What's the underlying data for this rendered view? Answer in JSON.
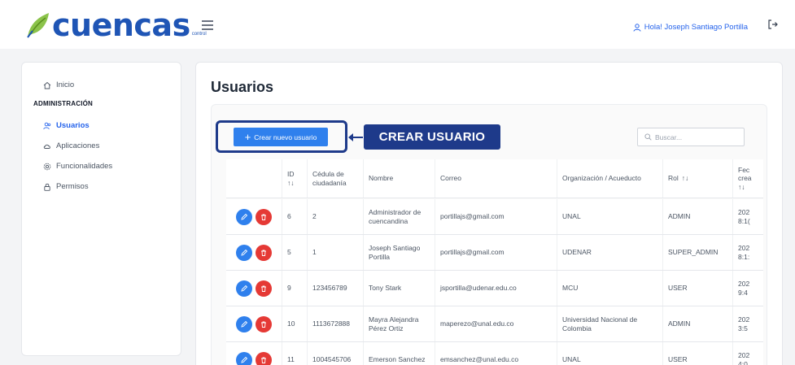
{
  "header": {
    "logo_text": "cuencas",
    "logo_sub": "control",
    "greeting": "Hola! Joseph Santiago Portilla"
  },
  "sidebar": {
    "home": "Inicio",
    "section": "ADMINISTRACIÓN",
    "items": [
      {
        "label": "Usuarios",
        "icon": "users-icon",
        "active": true
      },
      {
        "label": "Aplicaciones",
        "icon": "cloud-icon",
        "active": false
      },
      {
        "label": "Funcionalidades",
        "icon": "gear-icon",
        "active": false
      },
      {
        "label": "Permisos",
        "icon": "lock-icon",
        "active": false
      }
    ]
  },
  "main": {
    "title": "Usuarios",
    "create_button": "Crear nuevo usuario",
    "annotation": "CREAR USUARIO",
    "search_placeholder": "Buscar..."
  },
  "table": {
    "headers": {
      "id": "ID",
      "cedula": "Cédula de ciudadanía",
      "nombre": "Nombre",
      "correo": "Correo",
      "org": "Organización / Acueducto",
      "rol": "Rol",
      "fecha": "Fec crea"
    },
    "rows": [
      {
        "id": "6",
        "cedula": "2",
        "nombre": "Administrador de cuencandina",
        "correo": "portillajs@gmail.com",
        "org": "UNAL",
        "rol": "ADMIN",
        "fecha": "202 8:1("
      },
      {
        "id": "5",
        "cedula": "1",
        "nombre": "Joseph Santiago Portilla",
        "correo": "portillajs@gmail.com",
        "org": "UDENAR",
        "rol": "SUPER_ADMIN",
        "fecha": "202 8:1:"
      },
      {
        "id": "9",
        "cedula": "123456789",
        "nombre": "Tony Stark",
        "correo": "jsportilla@udenar.edu.co",
        "org": "MCU",
        "rol": "USER",
        "fecha": "202 9:4"
      },
      {
        "id": "10",
        "cedula": "1113672888",
        "nombre": "Mayra Alejandra Pérez Ortiz",
        "correo": "maperezo@unal.edu.co",
        "org": "Universidad Nacional de Colombia",
        "rol": "ADMIN",
        "fecha": "202 3:5"
      },
      {
        "id": "11",
        "cedula": "1004545706",
        "nombre": "Emerson Sanchez",
        "correo": "emsanchez@unal.edu.co",
        "org": "UNAL",
        "rol": "USER",
        "fecha": "202 4:0"
      }
    ]
  },
  "colors": {
    "primary": "#2f80ed",
    "brand": "#1f55b5",
    "danger": "#e53935",
    "annotation": "#1e3a8a"
  }
}
